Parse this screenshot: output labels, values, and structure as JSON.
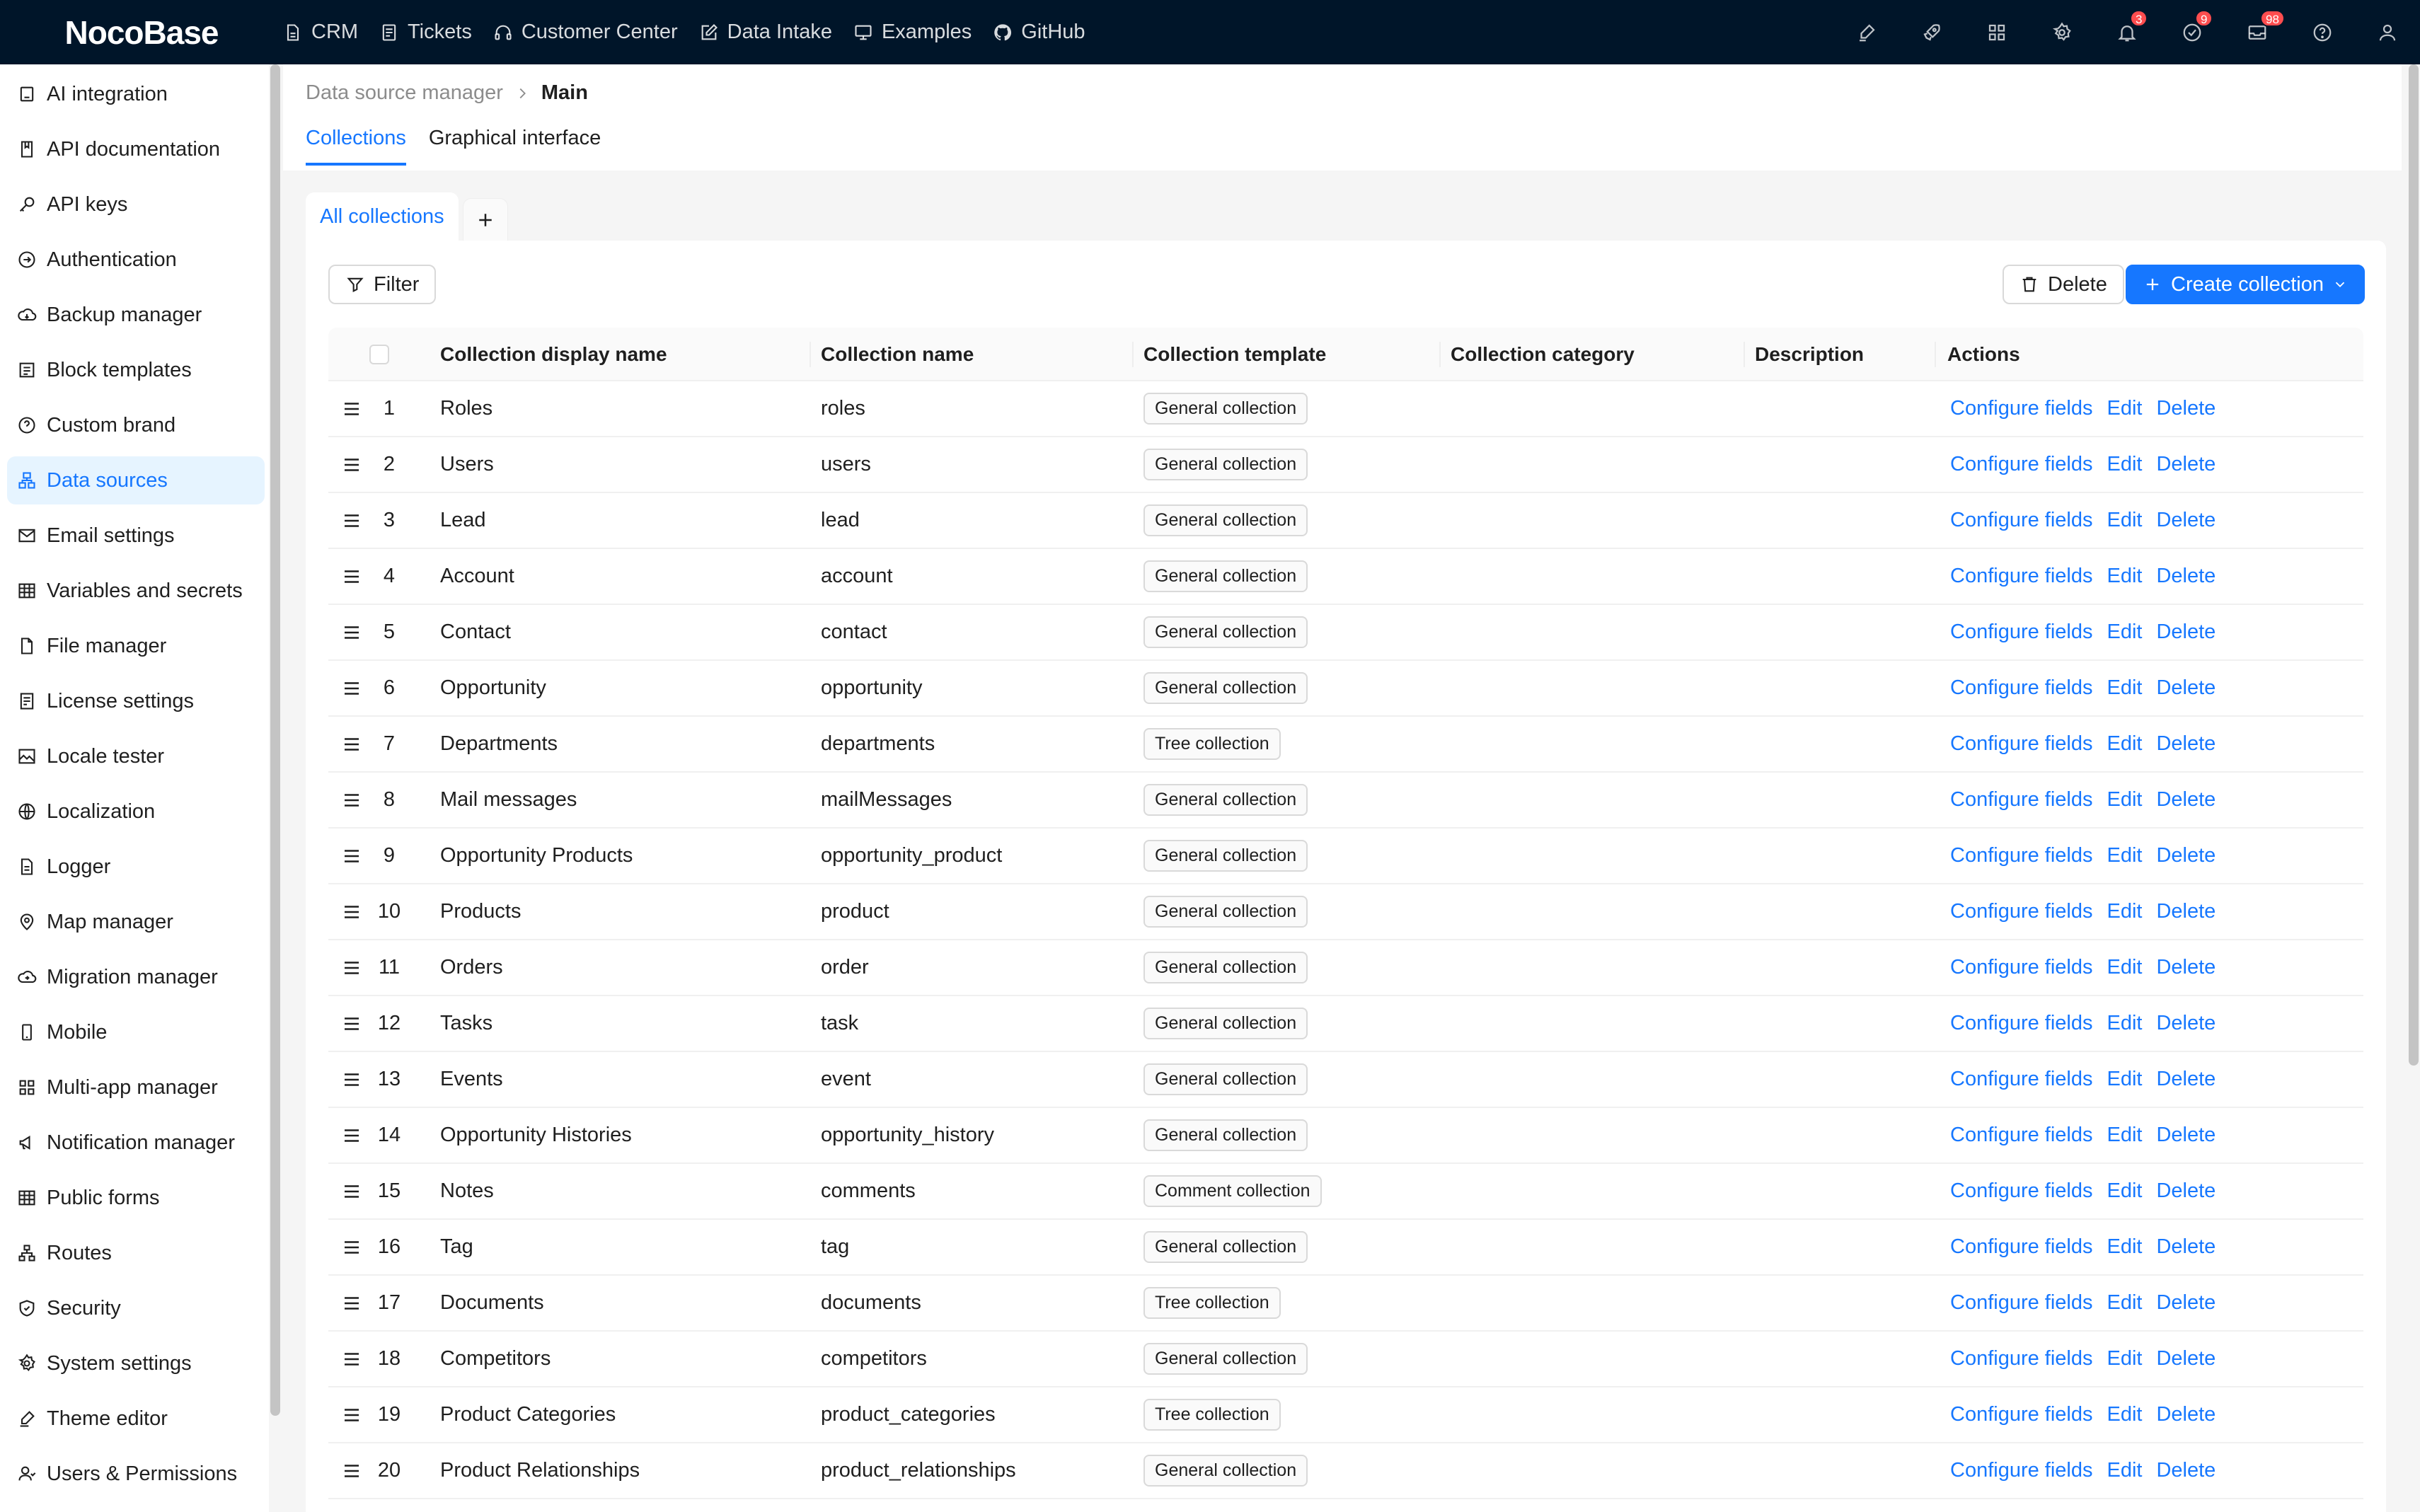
{
  "app": {
    "logo": "NocoBase"
  },
  "topnav": [
    {
      "label": "CRM",
      "icon": "file-icon"
    },
    {
      "label": "Tickets",
      "icon": "doc-icon"
    },
    {
      "label": "Customer Center",
      "icon": "headset-icon"
    },
    {
      "label": "Data Intake",
      "icon": "edit-icon"
    },
    {
      "label": "Examples",
      "icon": "monitor-icon"
    },
    {
      "label": "GitHub",
      "icon": "github-icon"
    }
  ],
  "topright": {
    "notifications_count": "3",
    "tasks_count": "9",
    "inbox_count": "98"
  },
  "sidebar": {
    "items": [
      {
        "label": "AI integration"
      },
      {
        "label": "API documentation"
      },
      {
        "label": "API keys"
      },
      {
        "label": "Authentication"
      },
      {
        "label": "Backup manager"
      },
      {
        "label": "Block templates"
      },
      {
        "label": "Custom brand"
      },
      {
        "label": "Data sources"
      },
      {
        "label": "Email settings"
      },
      {
        "label": "Variables and secrets"
      },
      {
        "label": "File manager"
      },
      {
        "label": "License settings"
      },
      {
        "label": "Locale tester"
      },
      {
        "label": "Localization"
      },
      {
        "label": "Logger"
      },
      {
        "label": "Map manager"
      },
      {
        "label": "Migration manager"
      },
      {
        "label": "Mobile"
      },
      {
        "label": "Multi-app manager"
      },
      {
        "label": "Notification manager"
      },
      {
        "label": "Public forms"
      },
      {
        "label": "Routes"
      },
      {
        "label": "Security"
      },
      {
        "label": "System settings"
      },
      {
        "label": "Theme editor"
      },
      {
        "label": "Users & Permissions"
      }
    ],
    "active": "Data sources"
  },
  "breadcrumb": {
    "parent": "Data source manager",
    "current": "Main"
  },
  "page_tabs": {
    "collections": "Collections",
    "graphical": "Graphical interface"
  },
  "collection_tabs": {
    "all": "All collections"
  },
  "toolbar": {
    "filter": "Filter",
    "delete": "Delete",
    "create": "Create collection"
  },
  "colors": {
    "primary": "#1677ff",
    "header_bg": "#001529",
    "badge": "#ff4d4f",
    "active_bg": "#e6f4ff"
  },
  "table": {
    "columns": {
      "display_name": "Collection display name",
      "name": "Collection name",
      "template": "Collection template",
      "category": "Collection category",
      "description": "Description",
      "actions": "Actions"
    },
    "action_labels": {
      "configure": "Configure fields",
      "edit": "Edit",
      "delete": "Delete"
    },
    "rows": [
      {
        "index": "1",
        "display": "Roles",
        "name": "roles",
        "template": "General collection"
      },
      {
        "index": "2",
        "display": "Users",
        "name": "users",
        "template": "General collection"
      },
      {
        "index": "3",
        "display": "Lead",
        "name": "lead",
        "template": "General collection"
      },
      {
        "index": "4",
        "display": "Account",
        "name": "account",
        "template": "General collection"
      },
      {
        "index": "5",
        "display": "Contact",
        "name": "contact",
        "template": "General collection"
      },
      {
        "index": "6",
        "display": "Opportunity",
        "name": "opportunity",
        "template": "General collection"
      },
      {
        "index": "7",
        "display": "Departments",
        "name": "departments",
        "template": "Tree collection"
      },
      {
        "index": "8",
        "display": "Mail messages",
        "name": "mailMessages",
        "template": "General collection"
      },
      {
        "index": "9",
        "display": "Opportunity Products",
        "name": "opportunity_product",
        "template": "General collection"
      },
      {
        "index": "10",
        "display": "Products",
        "name": "product",
        "template": "General collection"
      },
      {
        "index": "11",
        "display": "Orders",
        "name": "order",
        "template": "General collection"
      },
      {
        "index": "12",
        "display": "Tasks",
        "name": "task",
        "template": "General collection"
      },
      {
        "index": "13",
        "display": "Events",
        "name": "event",
        "template": "General collection"
      },
      {
        "index": "14",
        "display": "Opportunity Histories",
        "name": "opportunity_history",
        "template": "General collection"
      },
      {
        "index": "15",
        "display": "Notes",
        "name": "comments",
        "template": "Comment collection"
      },
      {
        "index": "16",
        "display": "Tag",
        "name": "tag",
        "template": "General collection"
      },
      {
        "index": "17",
        "display": "Documents",
        "name": "documents",
        "template": "Tree collection"
      },
      {
        "index": "18",
        "display": "Competitors",
        "name": "competitors",
        "template": "General collection"
      },
      {
        "index": "19",
        "display": "Product Categories",
        "name": "product_categories",
        "template": "Tree collection"
      },
      {
        "index": "20",
        "display": "Product Relationships",
        "name": "product_relationships",
        "template": "General collection"
      }
    ]
  }
}
